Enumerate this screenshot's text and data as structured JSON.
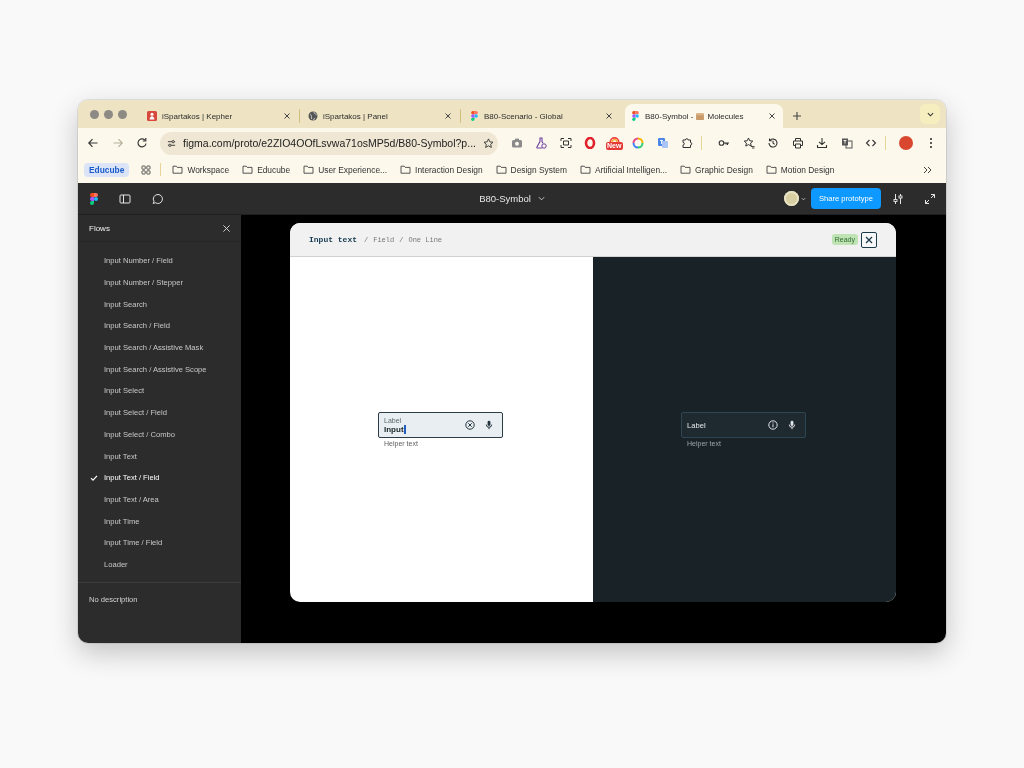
{
  "browser": {
    "tabs": [
      {
        "kind": "app",
        "title": "iSpartakos | Kepher",
        "selected": false
      },
      {
        "kind": "web",
        "title": "iSpartakos | Panel",
        "selected": false
      },
      {
        "kind": "logo",
        "title": "B80-Scenario - Global",
        "selected": false
      },
      {
        "kind": "logo",
        "title": "B80-Symbol -",
        "title_end": "Molecules",
        "selected": true
      }
    ],
    "back": {
      "disabled": false
    },
    "forward": {
      "disabled": true
    },
    "url": "figma.com/proto/e2ZIO4OOfLsvwa71osMP5d/B80-Symbol?p...",
    "extension_badge": "New",
    "tab_group": "Educube",
    "bookmarks": [
      "Workspace",
      "Educube",
      "User Experience...",
      "Interaction Design",
      "Design System",
      "Artificial Intelligen...",
      "Graphic Design",
      "Motion Design"
    ]
  },
  "figma_toolbar": {
    "file_name": "B80-Symbol",
    "share_button": "Share prototype"
  },
  "sidebar": {
    "title": "Flows",
    "flows": [
      {
        "label": "Input Number / Field",
        "selected": false
      },
      {
        "label": "Input Number / Stepper",
        "selected": false
      },
      {
        "label": "Input Search",
        "selected": false
      },
      {
        "label": "Input Search / Field",
        "selected": false
      },
      {
        "label": "Input Search / Assistive Mask",
        "selected": false
      },
      {
        "label": "Input Search / Assistive Scope",
        "selected": false
      },
      {
        "label": "Input Select",
        "selected": false
      },
      {
        "label": "Input Select / Field",
        "selected": false
      },
      {
        "label": "Input Select / Combo",
        "selected": false
      },
      {
        "label": "Input Text",
        "selected": false
      },
      {
        "label": "Input Text / Field",
        "selected": true
      },
      {
        "label": "Input Text / Area",
        "selected": false
      },
      {
        "label": "Input Time",
        "selected": false
      },
      {
        "label": "Input Time / Field",
        "selected": false
      },
      {
        "label": "Loader",
        "selected": false
      }
    ],
    "description": "No description"
  },
  "frame": {
    "breadcrumb": [
      {
        "kind": "title",
        "text": "Input text"
      },
      {
        "kind": "separator",
        "text": "/"
      },
      {
        "kind": "crumb",
        "text": "Field"
      },
      {
        "kind": "separator",
        "text": "/"
      },
      {
        "kind": "crumb",
        "text": "One Line"
      }
    ],
    "status": "Ready",
    "previews": [
      {
        "kind": "light",
        "field": {
          "label": "Label",
          "value": "Input",
          "focused": true
        },
        "helper": "Helper text"
      },
      {
        "kind": "dark",
        "field": {
          "label": "Label",
          "focused": false
        },
        "helper": "Helper text"
      }
    ]
  }
}
